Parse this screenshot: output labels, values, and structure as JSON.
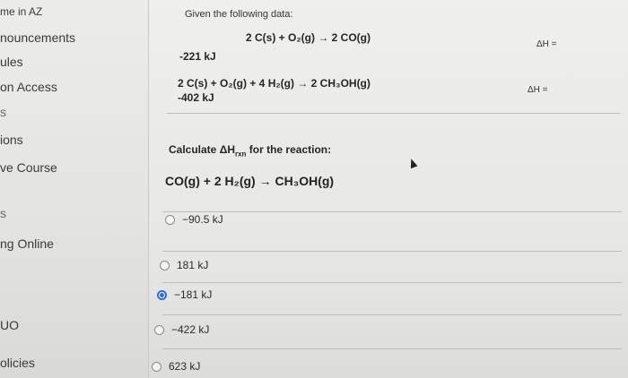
{
  "sidebar": {
    "items": [
      {
        "label": "me in AZ"
      },
      {
        "label": "nouncements"
      },
      {
        "label": "ules"
      },
      {
        "label": "on Access"
      },
      {
        "label": "s"
      },
      {
        "label": "ions"
      },
      {
        "label": "ve Course"
      },
      {
        "label": "s"
      },
      {
        "label": "ng Online"
      },
      {
        "label": "UO"
      },
      {
        "label": "olicies"
      }
    ]
  },
  "question": {
    "given_label": "Given the following data:",
    "reactions": [
      {
        "equation": "2 C(s) + O₂(g) → 2 CO(g)",
        "dh_label": "ΔH =",
        "value": "-221 kJ"
      },
      {
        "equation": "2 C(s) + O₂(g) + 4 H₂(g) → 2 CH₃OH(g)",
        "dh_label": "ΔH =",
        "value": "-402 kJ"
      }
    ],
    "prompt_prefix": "Calculate ΔH",
    "prompt_sub": "rxn",
    "prompt_suffix": " for the reaction:",
    "target_reaction": "CO(g) + 2 H₂(g) → CH₃OH(g)"
  },
  "options": [
    {
      "label": "−90.5 kJ",
      "selected": false
    },
    {
      "label": "181 kJ",
      "selected": false
    },
    {
      "label": "−181 kJ",
      "selected": true
    },
    {
      "label": "−422 kJ",
      "selected": false
    },
    {
      "label": "623 kJ",
      "selected": false
    }
  ],
  "colors": {
    "radio_selected": "#2d6bd6"
  }
}
